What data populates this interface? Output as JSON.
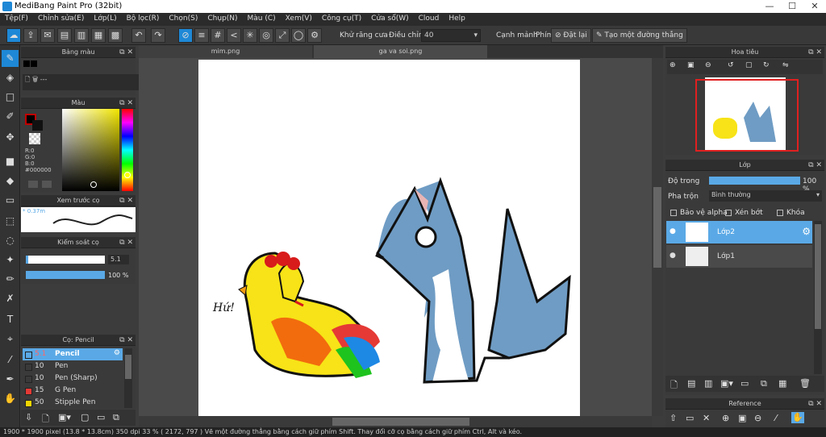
{
  "window": {
    "title": "MediBang Paint Pro (32bit)",
    "min": "—",
    "max": "☐",
    "close": "✕"
  },
  "menu": [
    "Tệp(F)",
    "Chỉnh sửa(E)",
    "Lớp(L)",
    "Bộ lọc(R)",
    "Chọn(S)",
    "Chụp(N)",
    "Màu (C)",
    "Xem(V)",
    "Công cụ(T)",
    "Cửa sổ(W)",
    "Cloud",
    "Help"
  ],
  "toolbar": {
    "antialias_label": "Khử răng cưa",
    "adjust_label": "Điều chỉnh",
    "adjust_value": "40",
    "edge_label": "Cạnh mảnh",
    "key_label": "Phím",
    "reset_label": "Đặt lại",
    "straight_label": "Tạo một đường thẳng"
  },
  "palette_panel": {
    "title": "Bảng màu",
    "extra": "---"
  },
  "color_panel": {
    "title": "Màu",
    "r": "R:0",
    "g": "G:0",
    "b": "B:0",
    "hex": "#000000",
    "primary_color": "#c00000"
  },
  "brush_preview_panel": {
    "title": "Xem trước cọ",
    "size_label": "* 0.37m"
  },
  "brush_control_panel": {
    "title": "Kiểm soát cọ",
    "size_value": "5.1",
    "opacity_value": "100 %",
    "opacity": 1.0
  },
  "brush_list_panel": {
    "title": "Cọ: Pencil",
    "items": [
      {
        "size": "5.1",
        "name": "Pencil",
        "color": "#333333",
        "selected": true
      },
      {
        "size": "10",
        "name": "Pen",
        "color": "#333333",
        "selected": false
      },
      {
        "size": "10",
        "name": "Pen (Sharp)",
        "color": "#333333",
        "selected": false
      },
      {
        "size": "15",
        "name": "G Pen",
        "color": "#e53935",
        "selected": false
      },
      {
        "size": "50",
        "name": "Stipple Pen",
        "color": "#f2d600",
        "selected": false
      }
    ]
  },
  "tabs": [
    {
      "label": "mim.png",
      "active": false
    },
    {
      "label": "ga va soi.png",
      "active": true
    }
  ],
  "navigator_panel": {
    "title": "Hoa tiêu"
  },
  "layer_panel": {
    "title": "Lớp",
    "opacity_label": "Độ trong",
    "opacity_value": "100 %",
    "opacity": 1.0,
    "blend_label": "Pha trộn",
    "blend_value": "Bình thường",
    "protect_alpha": "Bảo vệ alpha",
    "clipping": "Xén bớt",
    "lock": "Khóa",
    "layers": [
      {
        "name": "Lớp2",
        "selected": true
      },
      {
        "name": "Lớp1",
        "selected": false
      }
    ]
  },
  "reference_panel": {
    "title": "Reference"
  },
  "canvas_text": "Hứ!",
  "statusbar": "1900 * 1900 pixel   (13.8 * 13.8cm)   350 dpi   33 %   ( 2172, 797 )   Vẽ một đường thẳng bằng cách giữ phím Shift. Thay đổi cỡ cọ bằng cách giữ phím Ctrl, Alt và kéo."
}
